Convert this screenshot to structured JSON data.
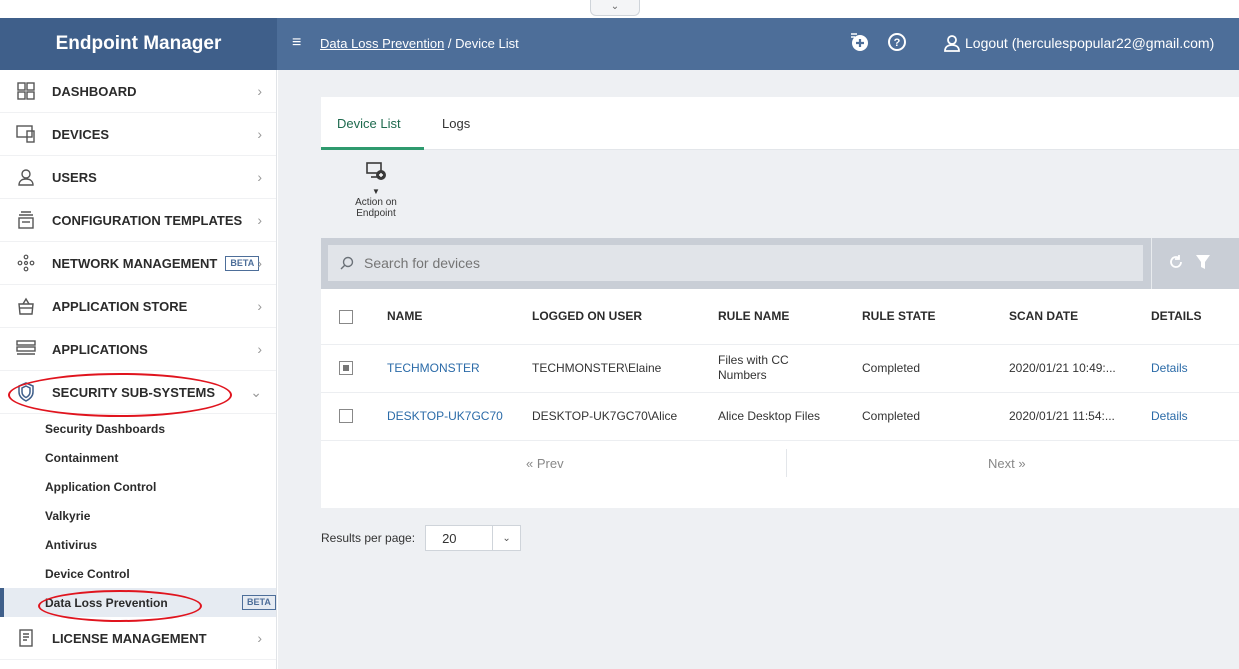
{
  "app": {
    "title": "Endpoint Manager"
  },
  "header": {
    "breadcrumb_link": "Data Loss Prevention",
    "breadcrumb_sep": "/",
    "breadcrumb_current": "Device List",
    "logout_label": "Logout (herculespopular22@gmail.com)",
    "icons": [
      "add-icon",
      "help-icon",
      "user-icon"
    ]
  },
  "sidebar": {
    "items": [
      {
        "label": "DASHBOARD",
        "icon": "dashboard-icon"
      },
      {
        "label": "DEVICES",
        "icon": "devices-icon"
      },
      {
        "label": "USERS",
        "icon": "user-icon"
      },
      {
        "label": "CONFIGURATION TEMPLATES",
        "icon": "templates-icon"
      },
      {
        "label": "NETWORK MANAGEMENT",
        "badge": "BETA",
        "icon": "network-icon"
      },
      {
        "label": "APPLICATION STORE",
        "icon": "store-icon"
      },
      {
        "label": "APPLICATIONS",
        "icon": "applications-icon"
      },
      {
        "label": "SECURITY SUB-SYSTEMS",
        "icon": "shield-icon",
        "expanded": true
      },
      {
        "label": "LICENSE MANAGEMENT",
        "icon": "license-icon"
      }
    ],
    "subitems": [
      {
        "label": "Security Dashboards"
      },
      {
        "label": "Containment"
      },
      {
        "label": "Application Control"
      },
      {
        "label": "Valkyrie"
      },
      {
        "label": "Antivirus"
      },
      {
        "label": "Device Control"
      },
      {
        "label": "Data Loss Prevention",
        "badge": "BETA",
        "active": true
      }
    ]
  },
  "main": {
    "tabs": [
      {
        "label": "Device List",
        "active": true
      },
      {
        "label": "Logs"
      }
    ],
    "action": {
      "label_line1": "Action on",
      "label_line2": "Endpoint"
    },
    "search": {
      "placeholder": "Search for devices"
    },
    "table": {
      "columns": [
        "NAME",
        "LOGGED ON USER",
        "RULE NAME",
        "RULE STATE",
        "SCAN DATE",
        "DETAILS"
      ],
      "rows": [
        {
          "checked": true,
          "name": "TECHMONSTER",
          "user": "TECHMONSTER\\Elaine",
          "rule_name": "Files with CC Numbers",
          "rule_state": "Completed",
          "scan_date": "2020/01/21 10:49:...",
          "details": "Details"
        },
        {
          "checked": false,
          "name": "DESKTOP-UK7GC70",
          "user": "DESKTOP-UK7GC70\\Alice",
          "rule_name": "Alice Desktop Files",
          "rule_state": "Completed",
          "scan_date": "2020/01/21 11:54:...",
          "details": "Details"
        }
      ]
    },
    "pager": {
      "prev": "«  Prev",
      "next": "Next  »"
    },
    "results_per_page": {
      "label": "Results per page:",
      "value": "20"
    }
  },
  "colors": {
    "header": "#4d6e99",
    "brand": "#3f5f8a",
    "tab_active": "#2e9a6e",
    "link": "#2b6ba8",
    "highlight": "#e0141e"
  }
}
